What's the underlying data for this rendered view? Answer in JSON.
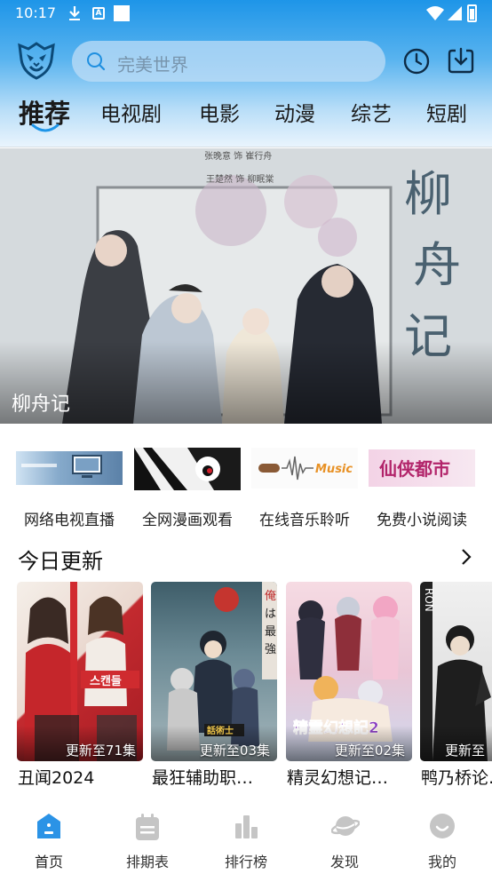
{
  "status_bar": {
    "time": "10:17"
  },
  "search": {
    "placeholder": "完美世界"
  },
  "tabs": [
    {
      "label": "推荐",
      "active": true
    },
    {
      "label": "电视剧"
    },
    {
      "label": "电影"
    },
    {
      "label": "动漫"
    },
    {
      "label": "综艺"
    },
    {
      "label": "短剧"
    }
  ],
  "banner": {
    "title": "柳舟记",
    "poster_text": {
      "calligraphy": "柳舟记",
      "cast_line_1": "张晚意 饰 崔行舟",
      "cast_line_2": "王楚然 饰 柳眠棠"
    }
  },
  "quick_links": [
    {
      "label": "网络电视直播"
    },
    {
      "label": "全网漫画观看"
    },
    {
      "label": "在线音乐聆听",
      "thumb_text": "Music"
    },
    {
      "label": "免费小说阅读",
      "thumb_text": "仙侠都市"
    }
  ],
  "today": {
    "title": "今日更新",
    "items": [
      {
        "title": "丑闻2024",
        "badge": "更新至71集",
        "poster_text": "스캔들"
      },
      {
        "title": "最狂辅助职…",
        "badge": "更新至03集",
        "poster_text": "話術士"
      },
      {
        "title": "精灵幻想记…",
        "badge": "更新至02集",
        "poster_text": "精霊幻想記2"
      },
      {
        "title": "鸭乃桥论…",
        "badge": "更新至",
        "poster_text": "RON"
      }
    ]
  },
  "bottom_nav": [
    {
      "label": "首页",
      "icon": "home-icon",
      "active": true
    },
    {
      "label": "排期表",
      "icon": "calendar-icon"
    },
    {
      "label": "排行榜",
      "icon": "ranking-icon"
    },
    {
      "label": "发现",
      "icon": "planet-icon"
    },
    {
      "label": "我的",
      "icon": "profile-icon"
    }
  ],
  "colors": {
    "accent": "#1e95e8",
    "nav_active": "#2b93e6",
    "nav_inactive": "#c5c5c5"
  }
}
